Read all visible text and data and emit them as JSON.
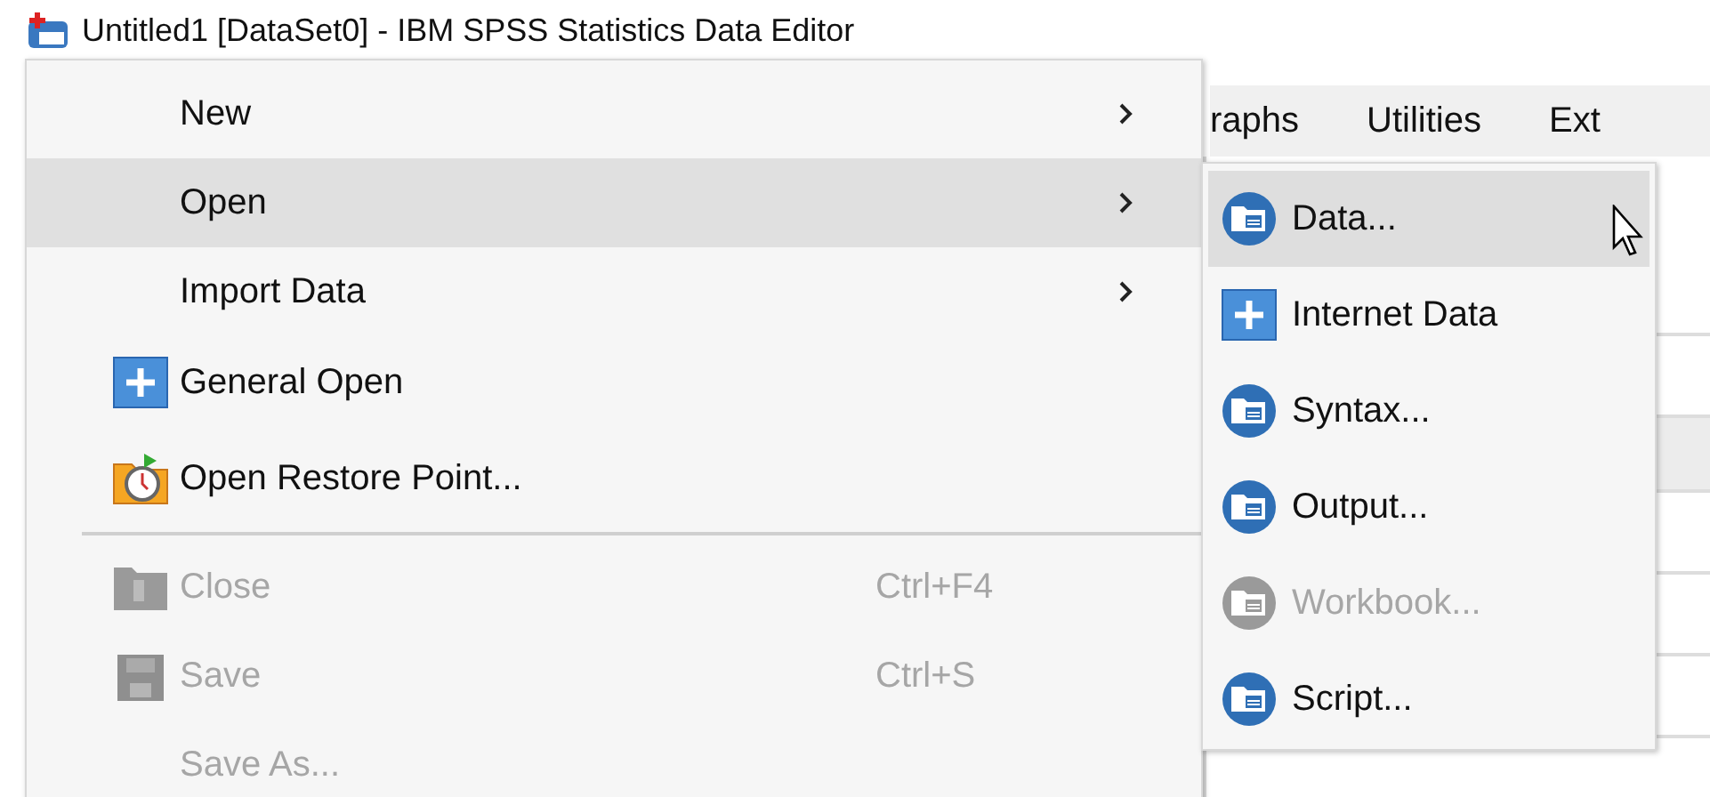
{
  "window": {
    "title": "Untitled1 [DataSet0] - IBM SPSS Statistics Data Editor"
  },
  "menubar": [
    "raphs",
    "Utilities",
    "Ext"
  ],
  "file_menu": [
    {
      "kind": "submenu",
      "label": "New",
      "selected": false,
      "disabled": false
    },
    {
      "kind": "submenu",
      "label": "Open",
      "selected": true,
      "disabled": false
    },
    {
      "kind": "submenu",
      "label": "Import Data",
      "selected": false,
      "disabled": false
    },
    {
      "kind": "plus",
      "label": "General Open",
      "selected": false,
      "disabled": false
    },
    {
      "kind": "restore",
      "label": "Open Restore Point...",
      "selected": false,
      "disabled": false
    },
    {
      "kind": "separator"
    },
    {
      "kind": "folder",
      "label": "Close",
      "shortcut": "Ctrl+F4",
      "selected": false,
      "disabled": true
    },
    {
      "kind": "disk",
      "label": "Save",
      "shortcut": "Ctrl+S",
      "selected": false,
      "disabled": true
    },
    {
      "kind": "plain",
      "label": "Save As...",
      "selected": false,
      "disabled": true
    }
  ],
  "open_submenu": [
    {
      "kind": "document",
      "label": "Data...",
      "selected": true,
      "disabled": false
    },
    {
      "kind": "plus",
      "label": "Internet Data",
      "selected": false,
      "disabled": false
    },
    {
      "kind": "document",
      "label": "Syntax...",
      "selected": false,
      "disabled": false
    },
    {
      "kind": "document",
      "label": "Output...",
      "selected": false,
      "disabled": false
    },
    {
      "kind": "document",
      "label": "Workbook...",
      "selected": false,
      "disabled": true
    },
    {
      "kind": "document",
      "label": "Script...",
      "selected": false,
      "disabled": false
    }
  ]
}
